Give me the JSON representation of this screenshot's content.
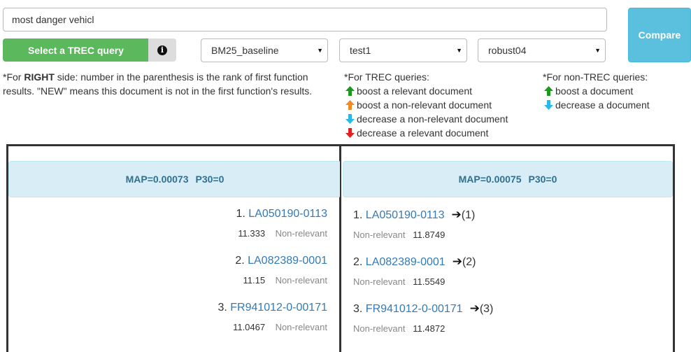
{
  "search": {
    "query": "most danger vehicl"
  },
  "toolbar": {
    "trec_button": "Select a TREC query",
    "info_glyph": "i",
    "compare_button": "Compare",
    "function_a": "BM25_baseline",
    "function_b": "test1",
    "collection": "robust04"
  },
  "notes": {
    "right_side_prefix": "*For ",
    "right_side_bold": "RIGHT",
    "right_side_rest_1": " side: number in the parenthesis is the rank of first function",
    "right_side_rest_2": "results. \"NEW\" means this document is not in the first function's results.",
    "trec_title": "*For TREC queries:",
    "trec_items": [
      {
        "icon": "arrow-up-green-icon",
        "color": "#1a9a1a",
        "text": "boost a relevant document"
      },
      {
        "icon": "arrow-up-orange-icon",
        "color": "#f08a24",
        "text": "boost a non-relevant document"
      },
      {
        "icon": "arrow-down-cyan-icon",
        "color": "#2ab8e6",
        "text": "decrease a non-relevant document"
      },
      {
        "icon": "arrow-down-red-icon",
        "color": "#e02020",
        "text": "decrease a relevant document"
      }
    ],
    "nontrec_title": "*For non-TREC queries:",
    "nontrec_items": [
      {
        "icon": "arrow-up-green-icon",
        "color": "#1a9a1a",
        "text": "boost a document"
      },
      {
        "icon": "arrow-down-cyan-icon",
        "color": "#2ab8e6",
        "text": "decrease a document"
      }
    ]
  },
  "left_panel": {
    "map": "MAP=0.00073",
    "p30": "P30=0",
    "results": [
      {
        "rank": "1.",
        "doc": "LA050190-0113",
        "score": "11.333",
        "label": "Non-relevant"
      },
      {
        "rank": "2.",
        "doc": "LA082389-0001",
        "score": "11.15",
        "label": "Non-relevant"
      },
      {
        "rank": "3.",
        "doc": "FR941012-0-00171",
        "score": "11.0467",
        "label": "Non-relevant"
      }
    ]
  },
  "right_panel": {
    "map": "MAP=0.00075",
    "p30": "P30=0",
    "results": [
      {
        "rank": "1.",
        "doc": "LA050190-0113",
        "prev": "(1)",
        "score": "11.8749",
        "label": "Non-relevant"
      },
      {
        "rank": "2.",
        "doc": "LA082389-0001",
        "prev": "(2)",
        "score": "11.5549",
        "label": "Non-relevant"
      },
      {
        "rank": "3.",
        "doc": "FR941012-0-00171",
        "prev": "(3)",
        "score": "11.4872",
        "label": "Non-relevant"
      }
    ]
  },
  "colors": {
    "trec_button": "#5cb85c",
    "compare_button": "#5bc0de",
    "link": "#337ab7",
    "map_bar": "#d9edf7",
    "map_text": "#31708f"
  }
}
